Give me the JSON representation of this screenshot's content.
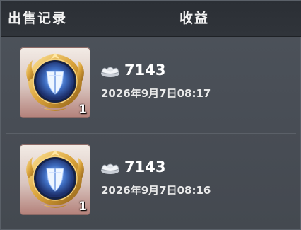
{
  "header": {
    "left_title": "出售记录",
    "right_title": "收益"
  },
  "records": [
    {
      "item_icon": "guardian-shield-emblem-icon",
      "count": "1",
      "currency_icon": "silver-ingot-icon",
      "amount": "7143",
      "time": "2026年9月7日08:17"
    },
    {
      "item_icon": "guardian-shield-emblem-icon",
      "count": "1",
      "currency_icon": "silver-ingot-icon",
      "amount": "7143",
      "time": "2026年9月7日08:16"
    }
  ],
  "colors": {
    "header_bg": "#2d3137",
    "panel_bg": "#4a4f57",
    "slot_bottom": "#b38079"
  }
}
